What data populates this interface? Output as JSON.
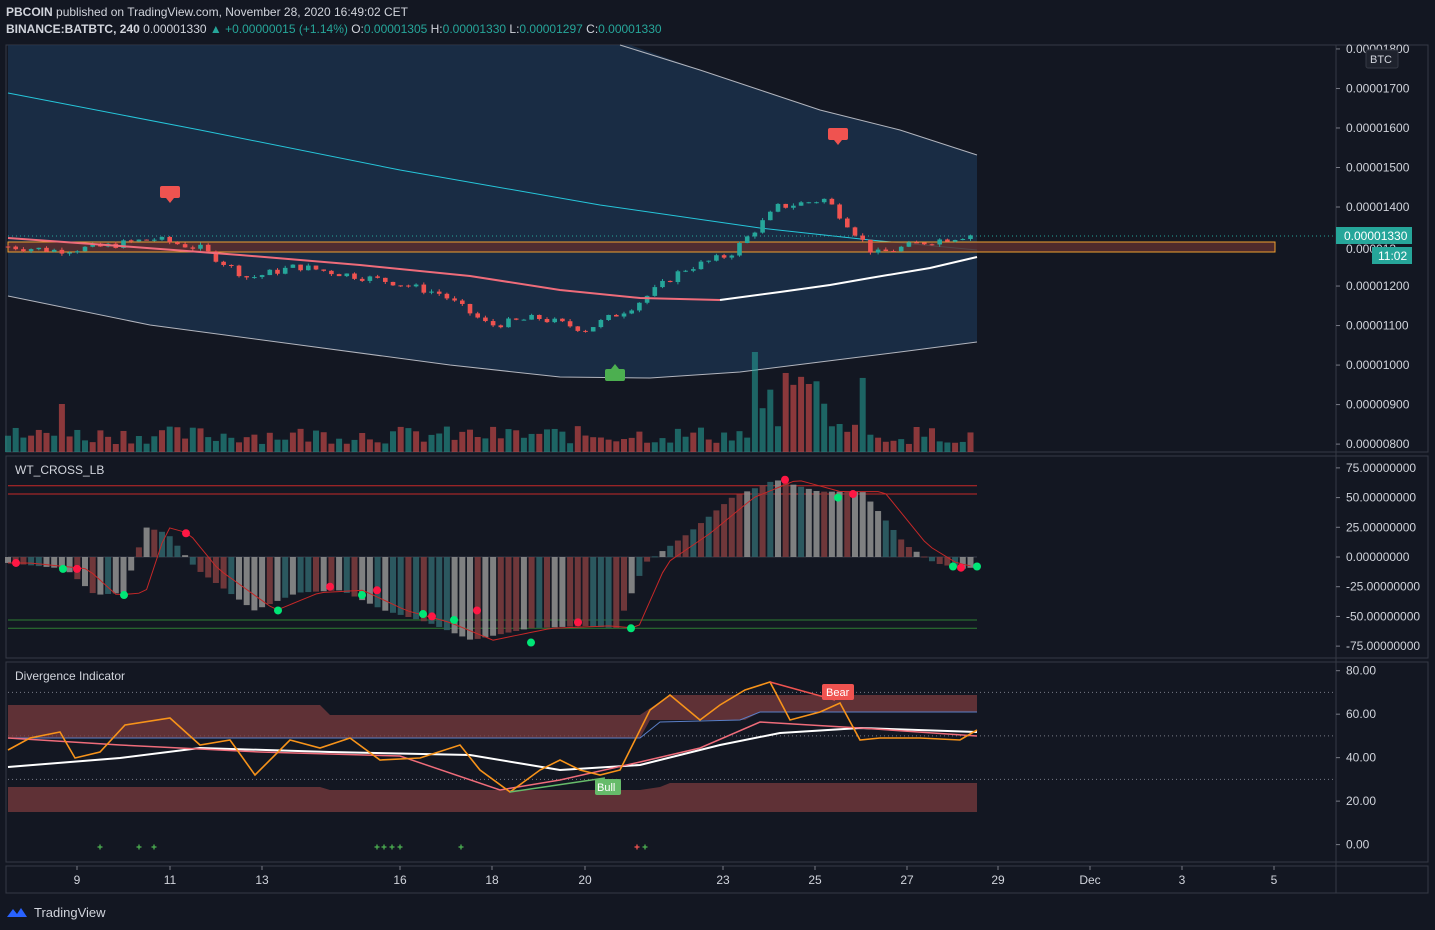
{
  "header": {
    "publisher": "PBCOIN",
    "published_text": "published on TradingView.com, November 28, 2020 16:49:02 CET",
    "symbol": "BINANCE:BATBTC, 240",
    "last": "0.00001330",
    "change": "▲ +0.00000015 (+1.14%)",
    "o_label": "O:",
    "o": "0.00001305",
    "h_label": "H:",
    "h": "0.00001330",
    "l_label": "L:",
    "l": "0.00001297",
    "c_label": "C:",
    "c": "0.00001330"
  },
  "panes": {
    "price": {
      "currency_badge": "BTC",
      "price_tag": "0.00001330",
      "countdown_tag": "11:02",
      "partial_tag": "0.000013",
      "y_ticks": [
        "0.00001800",
        "0.00001700",
        "0.00001600",
        "0.00001500",
        "0.00001400",
        "0.00001200",
        "0.00001100",
        "0.00001000",
        "0.00000900",
        "0.00000800"
      ],
      "signal_labels": [
        "Sell",
        "Sell",
        "Buy"
      ]
    },
    "wt": {
      "title": "WT_CROSS_LB",
      "y_ticks": [
        "75.00000000",
        "50.00000000",
        "25.00000000",
        "0.00000000",
        "-25.00000000",
        "-50.00000000",
        "-75.00000000"
      ]
    },
    "div": {
      "title": "Divergence Indicator",
      "y_ticks": [
        "80.00",
        "60.00",
        "40.00",
        "20.00",
        "0.00"
      ],
      "bear_label": "Bear",
      "bull_label": "Bull"
    }
  },
  "x_axis": {
    "ticks": [
      "9",
      "11",
      "13",
      "16",
      "18",
      "20",
      "23",
      "25",
      "27",
      "29",
      "Dec",
      "3",
      "5"
    ]
  },
  "footer": {
    "brand": "TradingView"
  },
  "chart_data": [
    {
      "type": "candlestick",
      "title": "BINANCE:BATBTC, 240",
      "x_dates": [
        "Nov 8",
        "Nov 9",
        "Nov 10",
        "Nov 11",
        "Nov 12",
        "Nov 13",
        "Nov 14",
        "Nov 15",
        "Nov 16",
        "Nov 17",
        "Nov 18",
        "Nov 19",
        "Nov 20",
        "Nov 21",
        "Nov 22",
        "Nov 23",
        "Nov 24",
        "Nov 25",
        "Nov 26",
        "Nov 27",
        "Nov 28"
      ],
      "close_approx": [
        1.3e-05,
        1.29e-05,
        1.3e-05,
        1.32e-05,
        1.295e-05,
        1.22e-05,
        1.25e-05,
        1.23e-05,
        1.21e-05,
        1.18e-05,
        1.1e-05,
        1.12e-05,
        1.09e-05,
        1.15e-05,
        1.24e-05,
        1.28e-05,
        1.4e-05,
        1.42e-05,
        1.28e-05,
        1.31e-05,
        1.33e-05
      ],
      "last_close": 1.33e-05,
      "ylim": [
        7.8e-06,
        1.81e-05
      ],
      "resistance_zone": [
        1.29e-05,
        1.31e-05
      ]
    },
    {
      "type": "histogram",
      "title": "WT_CROSS_LB",
      "ylim": [
        -85,
        85
      ],
      "levels": [
        60,
        53,
        -53,
        -60
      ]
    },
    {
      "type": "line",
      "title": "Divergence Indicator",
      "ylim": [
        -8,
        84
      ],
      "levels": [
        70,
        50,
        30
      ],
      "divergences": [
        "Bear",
        "Bull"
      ]
    }
  ]
}
